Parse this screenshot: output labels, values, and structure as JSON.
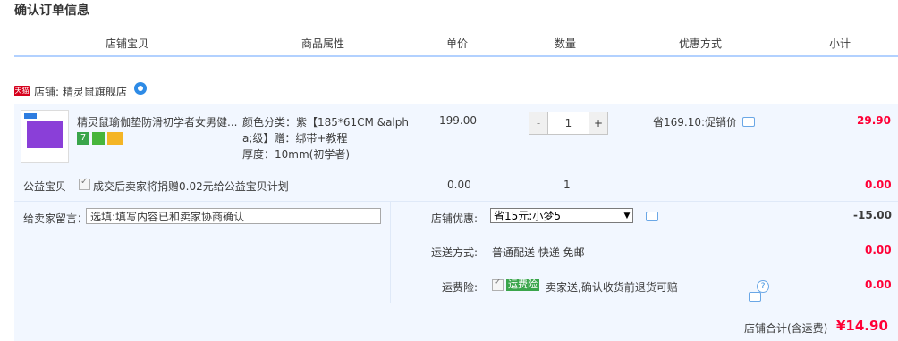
{
  "page": {
    "title": "确认订单信息"
  },
  "columns": [
    "店铺宝贝",
    "商品属性",
    "单价",
    "数量",
    "优惠方式",
    "小计"
  ],
  "shop": {
    "tmall_badge": "天猫",
    "label": "店铺: 精灵鼠旗舰店"
  },
  "item": {
    "name": "精灵鼠瑜伽垫防滑初学者女男健...",
    "badge_text": "7",
    "attrs": [
      "颜色分类：紫【185*61CM &alph",
      "a;级】赠：绑带+教程",
      "厚度：10mm(初学者)"
    ],
    "price": "199.00",
    "quantity": "1",
    "minus": "-",
    "plus": "+",
    "promo": "省169.10:促销价",
    "subtotal": "29.90"
  },
  "charity": {
    "label": "公益宝贝",
    "text": "成交后卖家将捐赠0.02元给公益宝贝计划",
    "price": "0.00",
    "quantity": "1",
    "subtotal": "0.00"
  },
  "memo": {
    "label": "给卖家留言：",
    "value": "选填:填写内容已和卖家协商确认"
  },
  "shop_discount": {
    "label": "店铺优惠:",
    "selected": "省15元:小梦5",
    "amount": "-15.00"
  },
  "shipping": {
    "label": "运送方式:",
    "value": "普通配送 快递 免邮",
    "amount": "0.00"
  },
  "insurance": {
    "label": "运费险:",
    "tag": "运费险",
    "text": "卖家送,确认收货前退货可赔",
    "amount": "0.00",
    "help": "?"
  },
  "total": {
    "label": "店铺合计(含运费)",
    "value": "¥14.90"
  },
  "colors": {
    "accent_red": "#ff0036",
    "row_bg": "#f2f7ff",
    "header_line": "#b2d1ff",
    "tmall_red": "#d6001c",
    "tag_green": "#3aa54b"
  }
}
